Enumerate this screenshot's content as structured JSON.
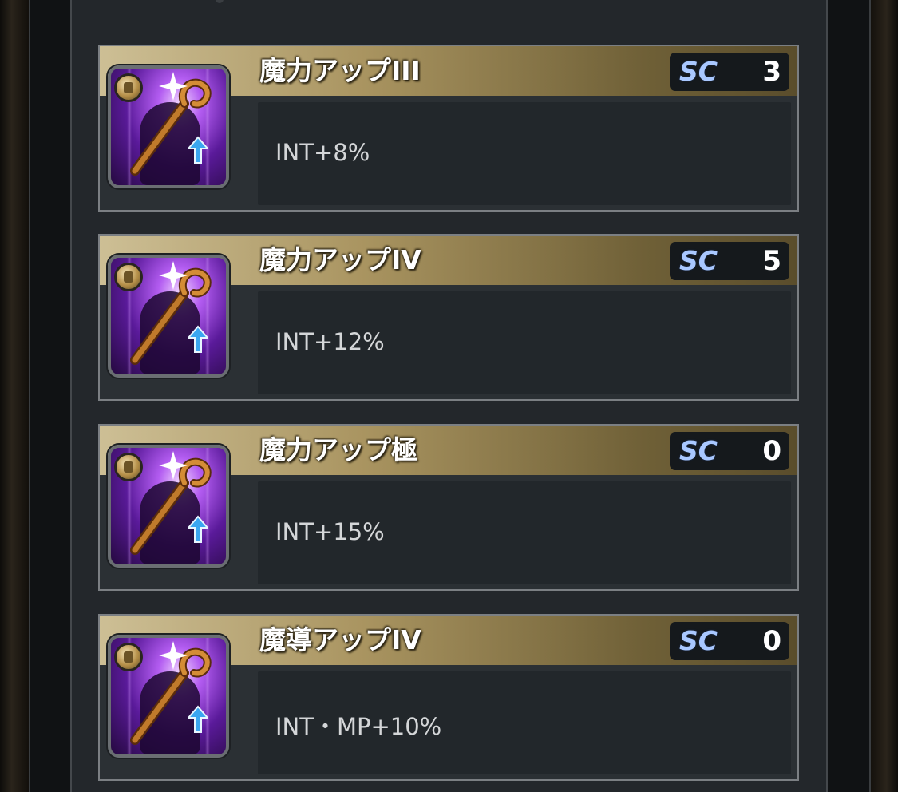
{
  "skills": [
    {
      "name": "魔力アップIII",
      "sc_label": "SC",
      "sc_value": "3",
      "effect": "INT+8%",
      "icon": "magic-staff-icon"
    },
    {
      "name": "魔力アップIV",
      "sc_label": "SC",
      "sc_value": "5",
      "effect": "INT+12%",
      "icon": "magic-staff-icon"
    },
    {
      "name": "魔力アップ極",
      "sc_label": "SC",
      "sc_value": "0",
      "effect": "INT+15%",
      "icon": "magic-staff-icon"
    },
    {
      "name": "魔導アップIV",
      "sc_label": "SC",
      "sc_value": "0",
      "effect": "INT・MP+10%",
      "icon": "magic-staff-icon"
    }
  ],
  "colors": {
    "header_gold": "#a99460",
    "sc_label": "#a9c8ff",
    "icon_purple": "#b35cf1"
  }
}
